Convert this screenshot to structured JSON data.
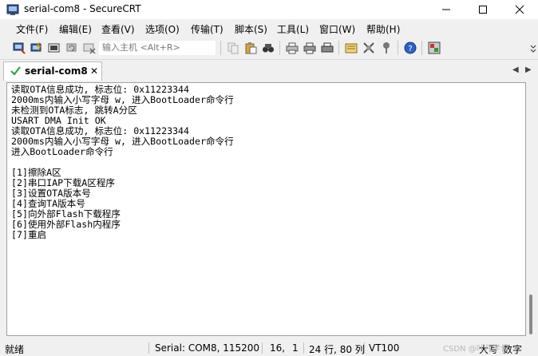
{
  "window": {
    "title": "serial-com8 - SecureCRT"
  },
  "menu": [
    "文件(F)",
    "编辑(E)",
    "查看(V)",
    "选项(O)",
    "传输(T)",
    "脚本(S)",
    "工具(L)",
    "窗口(W)",
    "帮助(H)"
  ],
  "toolbar": {
    "input_placeholder": "输入主机 <Alt+R>"
  },
  "tab": {
    "label": "serial-com8"
  },
  "terminal": {
    "lines": [
      "读取OTA信息成功, 标志位: 0x11223344",
      "2000ms内输入小写字母 w, 进入BootLoader命令行",
      "未检测到OTA标志, 跳转A分区",
      "USART DMA Init OK",
      "读取OTA信息成功, 标志位: 0x11223344",
      "2000ms内输入小写字母 w, 进入BootLoader命令行",
      "进入BootLoader命令行",
      "",
      "[1]擦除A区",
      "[2]串口IAP下载A区程序",
      "[3]设置OTA版本号",
      "[4]查询TA版本号",
      "[5]向外部Flash下载程序",
      "[6]使用外部Flash内程序",
      "[7]重启"
    ]
  },
  "status": {
    "ready": "就绪",
    "serial": "Serial: COM8, 115200",
    "row": "16,",
    "col": "1",
    "size": "24 行, 80 列",
    "emulation": "VT100",
    "caps": "大写",
    "num": "数字"
  },
  "watermark": "CSDN @叶凡学长"
}
